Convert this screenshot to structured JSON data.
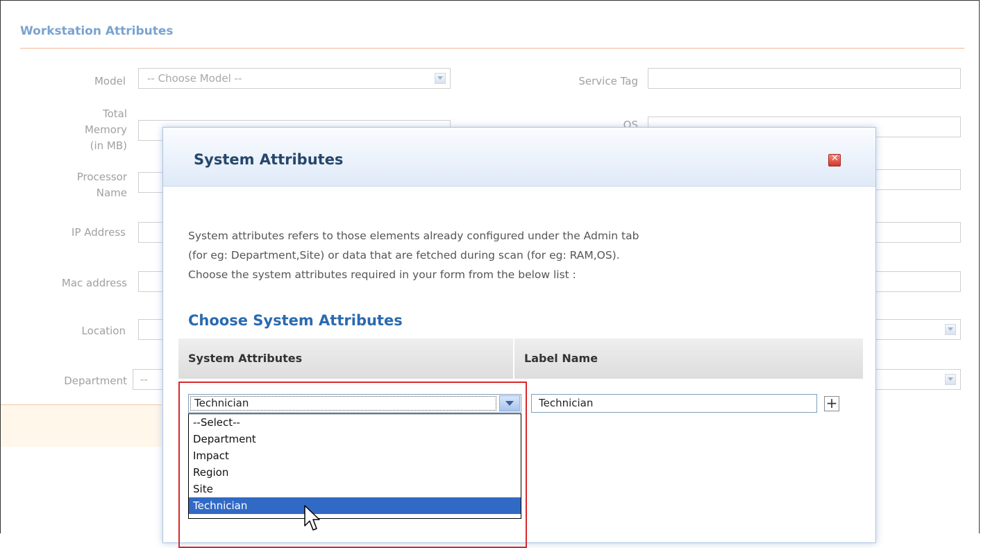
{
  "form": {
    "section_title": "Workstation Attributes",
    "fields": {
      "model": {
        "label": "Model",
        "placeholder": "-- Choose Model --"
      },
      "service_tag": {
        "label": "Service Tag"
      },
      "total_memory": {
        "label_line1": "Total",
        "label_line2": "Memory",
        "label_line3": "(in MB)"
      },
      "os": {
        "label": "OS"
      },
      "processor": {
        "label_line1": "Processor",
        "label_line2": "Name"
      },
      "ip_address": {
        "label": "IP Address"
      },
      "mac_address": {
        "label": "Mac address"
      },
      "location": {
        "label": "Location"
      },
      "department": {
        "label": "Department",
        "placeholder": "--"
      }
    }
  },
  "modal": {
    "title": "System Attributes",
    "close_icon": "close-icon",
    "description": {
      "line1": "System attributes refers to those elements already configured under the Admin tab",
      "line2": "(for eg: Department,Site) or data that are fetched during scan (for eg: RAM,OS).",
      "line3": "Choose the system attributes required in your form from the below list :"
    },
    "choose_title": "Choose System Attributes",
    "table": {
      "col1": "System Attributes",
      "col2": "Label Name"
    },
    "row": {
      "selected_attribute": "Technician",
      "label_name": "Technician",
      "add_label": "+"
    },
    "dropdown_options": [
      "--Select--",
      "Department",
      "Impact",
      "Region",
      "Site",
      "Technician"
    ],
    "dropdown_selected_index": 5
  },
  "colors": {
    "section_title": "#7aa3cf",
    "modal_title": "#26476b",
    "choose_title": "#2a6ab0",
    "highlight": "#316ac5",
    "red_outline": "#d8282c"
  }
}
